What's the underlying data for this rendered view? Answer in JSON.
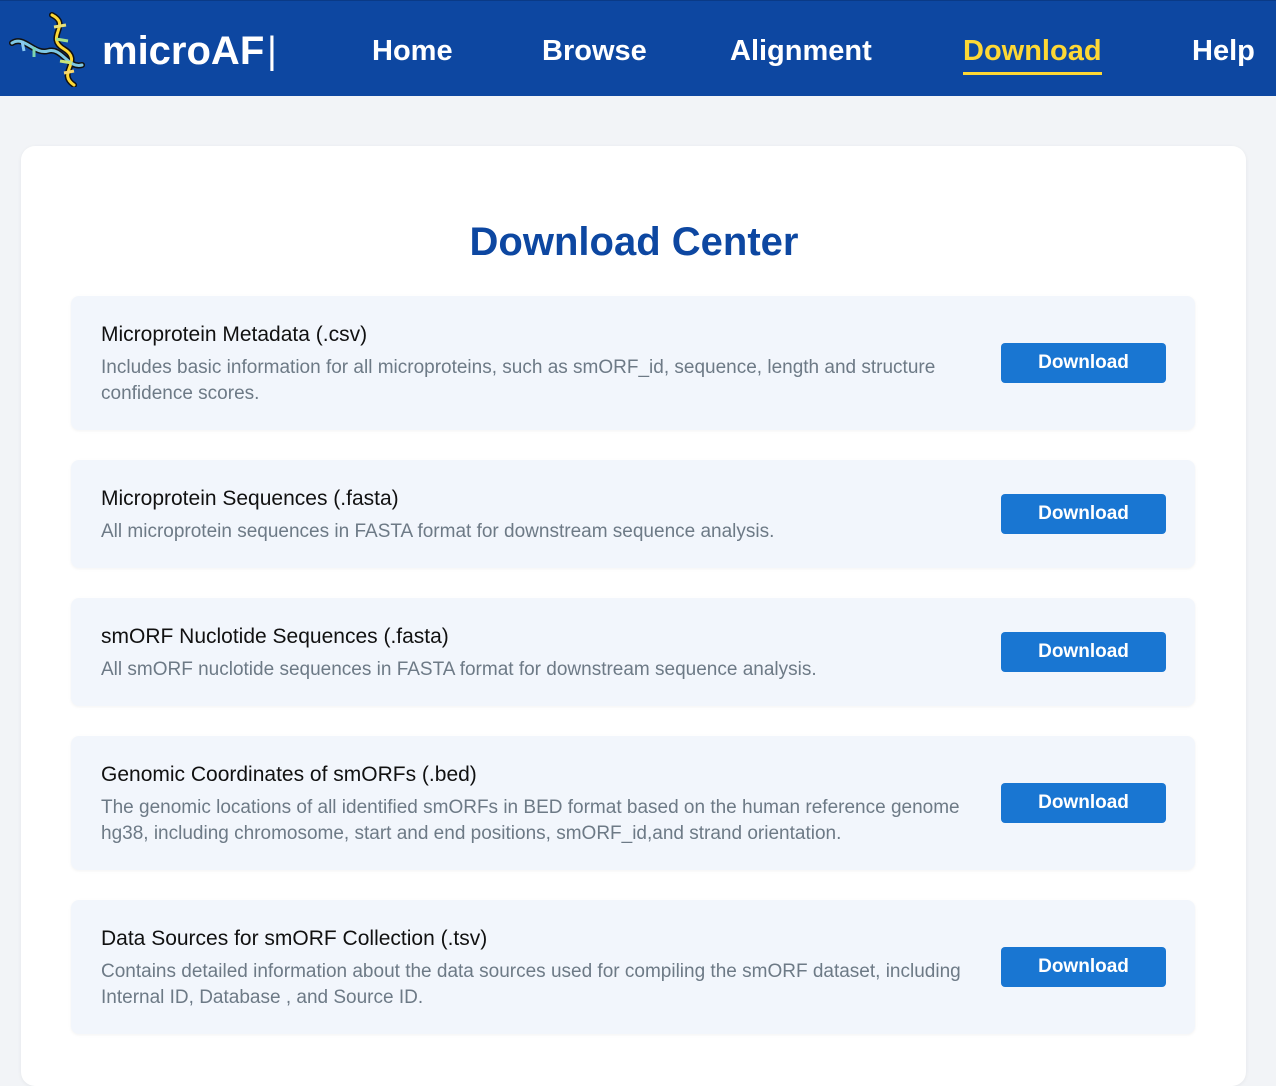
{
  "header": {
    "brand": "microAF",
    "separator": "|",
    "logo_icon": "dna-helix-icon",
    "nav": [
      {
        "label": "Home",
        "active": false
      },
      {
        "label": "Browse",
        "active": false
      },
      {
        "label": "Alignment",
        "active": false
      },
      {
        "label": "Download",
        "active": true
      },
      {
        "label": "Help",
        "active": false
      }
    ]
  },
  "colors": {
    "nav_background": "#0d47a1",
    "active_nav": "#fdd835",
    "title": "#0d47a1",
    "button": "#1976d2",
    "item_background": "#f2f6fc"
  },
  "main": {
    "title": "Download Center",
    "items": [
      {
        "title": "Microprotein Metadata (.csv)",
        "description": "Includes basic information for all microproteins, such as smORF_id, sequence, length and structure confidence scores.",
        "button": "Download"
      },
      {
        "title": "Microprotein Sequences (.fasta)",
        "description": "All microprotein sequences in FASTA format for downstream sequence analysis.",
        "button": "Download"
      },
      {
        "title": "smORF Nuclotide Sequences (.fasta)",
        "description": "All smORF nuclotide sequences in FASTA format for downstream sequence analysis.",
        "button": "Download"
      },
      {
        "title": "Genomic Coordinates of smORFs (.bed)",
        "description": "The genomic locations of all identified smORFs in BED format based on the human reference genome hg38, including chromosome, start and end positions, smORF_id,and strand orientation.",
        "button": "Download"
      },
      {
        "title": "Data Sources for smORF Collection (.tsv)",
        "description": "Contains detailed information about the data sources used for compiling the smORF dataset, including Internal ID, Database , and Source ID.",
        "button": "Download"
      }
    ]
  }
}
